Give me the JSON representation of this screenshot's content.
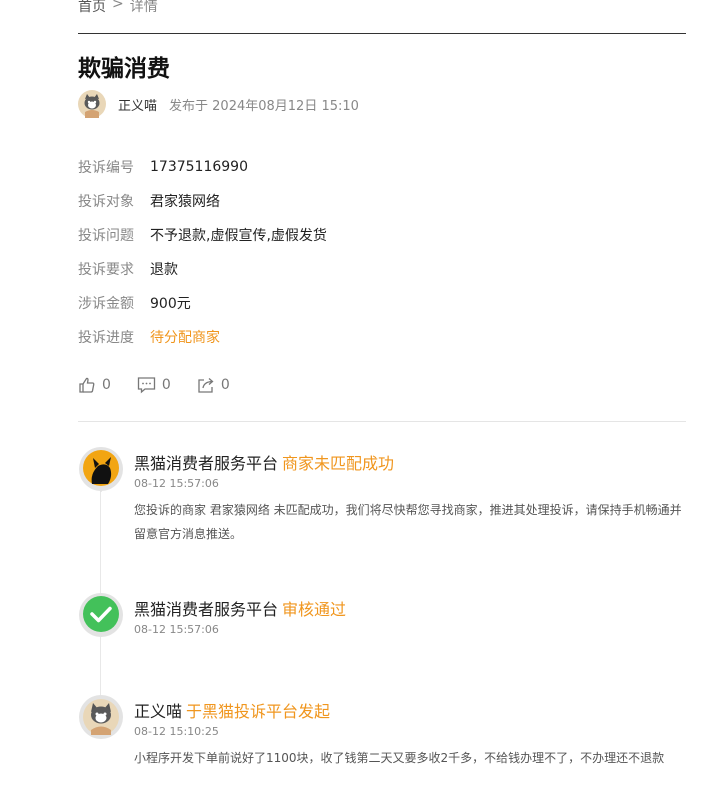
{
  "breadcrumb": {
    "home": "首页",
    "separator": ">",
    "current": "详情"
  },
  "complaint": {
    "title": "欺骗消费",
    "author": "正义喵",
    "published": "发布于 2024年08月12日 15:10",
    "fields": [
      {
        "key": "投诉编号",
        "value": "17375116990"
      },
      {
        "key": "投诉对象",
        "value": "君家猿网络"
      },
      {
        "key": "投诉问题",
        "value": "不予退款,虚假宣传,虚假发货"
      },
      {
        "key": "投诉要求",
        "value": "退款"
      },
      {
        "key": "涉诉金额",
        "value": "900元"
      },
      {
        "key": "投诉进度",
        "value": "待分配商家"
      }
    ],
    "progress_color": "#f0961e"
  },
  "actions": {
    "likes": "0",
    "comments": "0",
    "shares": "0"
  },
  "timeline": [
    {
      "actor": "黑猫消费者服务平台",
      "status": "商家未匹配成功",
      "time": "08-12 15:57:06",
      "desc": "您投诉的商家 君家猿网络 未匹配成功，我们将尽快帮您寻找商家，推进其处理投诉，请保持手机畅通并留意官方消息推送。",
      "icon": "black-cat-icon"
    },
    {
      "actor": "黑猫消费者服务平台",
      "status": "审核通过",
      "time": "08-12 15:57:06",
      "desc": "",
      "icon": "check-icon"
    },
    {
      "actor": "正义喵",
      "status": "于黑猫投诉平台发起",
      "time": "08-12 15:10:25",
      "desc": "小程序开发下单前说好了1100块，收了钱第二天又要多收2千多，不给钱办理不了，不办理还不退款",
      "icon": "user-avatar-icon"
    }
  ]
}
